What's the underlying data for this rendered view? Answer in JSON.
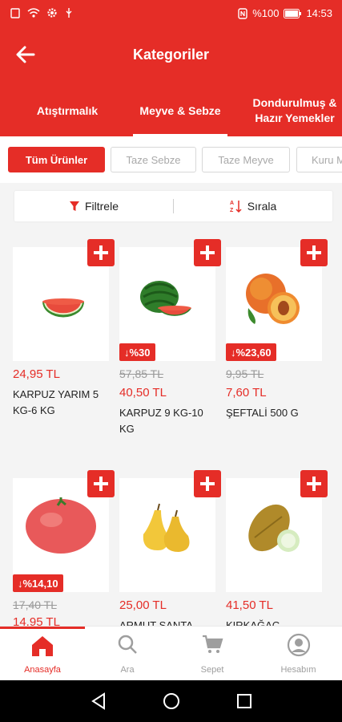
{
  "status_bar": {
    "battery": "%100",
    "time": "14:53"
  },
  "header": {
    "title": "Kategoriler"
  },
  "tabs": [
    {
      "label": "Atıştırmalık"
    },
    {
      "label": "Meyve & Sebze",
      "active": true
    },
    {
      "label": "Dondurulmuş & Hazır Yemekler"
    }
  ],
  "chips": [
    {
      "label": "Tüm Ürünler",
      "active": true
    },
    {
      "label": "Taze Sebze"
    },
    {
      "label": "Taze Meyve"
    },
    {
      "label": "Kuru M"
    }
  ],
  "toolbar": {
    "filter_label": "Filtrele",
    "sort_label": "Sırala"
  },
  "products": [
    {
      "name": "KARPUZ YARIM 5 KG-6 KG",
      "price": "24,95 TL",
      "old_price": "",
      "discount": "",
      "icon": "half-watermelon"
    },
    {
      "name": "KARPUZ 9 KG-10 KG",
      "price": "40,50 TL",
      "old_price": "57,85 TL",
      "discount": "%30",
      "icon": "watermelon"
    },
    {
      "name": "ŞEFTALİ  500 G",
      "price": "7,60 TL",
      "old_price": "9,95 TL",
      "discount": "%23,60",
      "icon": "peach"
    },
    {
      "name": "",
      "price": "14,95 TL",
      "old_price": "17,40 TL",
      "discount": "%14,10",
      "icon": "tomato"
    },
    {
      "name": "ARMUT SANTA",
      "price": "25,00 TL",
      "old_price": "",
      "discount": "",
      "icon": "pear"
    },
    {
      "name": "KIRKAĞAÇ",
      "price": "41,50 TL",
      "old_price": "",
      "discount": "",
      "icon": "melon"
    }
  ],
  "bottom_nav": [
    {
      "label": "Anasayfa",
      "active": true,
      "icon": "home-icon"
    },
    {
      "label": "Ara",
      "icon": "search-icon"
    },
    {
      "label": "Sepet",
      "icon": "cart-icon"
    },
    {
      "label": "Hesabım",
      "icon": "account-icon"
    }
  ],
  "colors": {
    "brand": "#e52d27",
    "text": "#222222",
    "muted": "#9a9a9a"
  }
}
